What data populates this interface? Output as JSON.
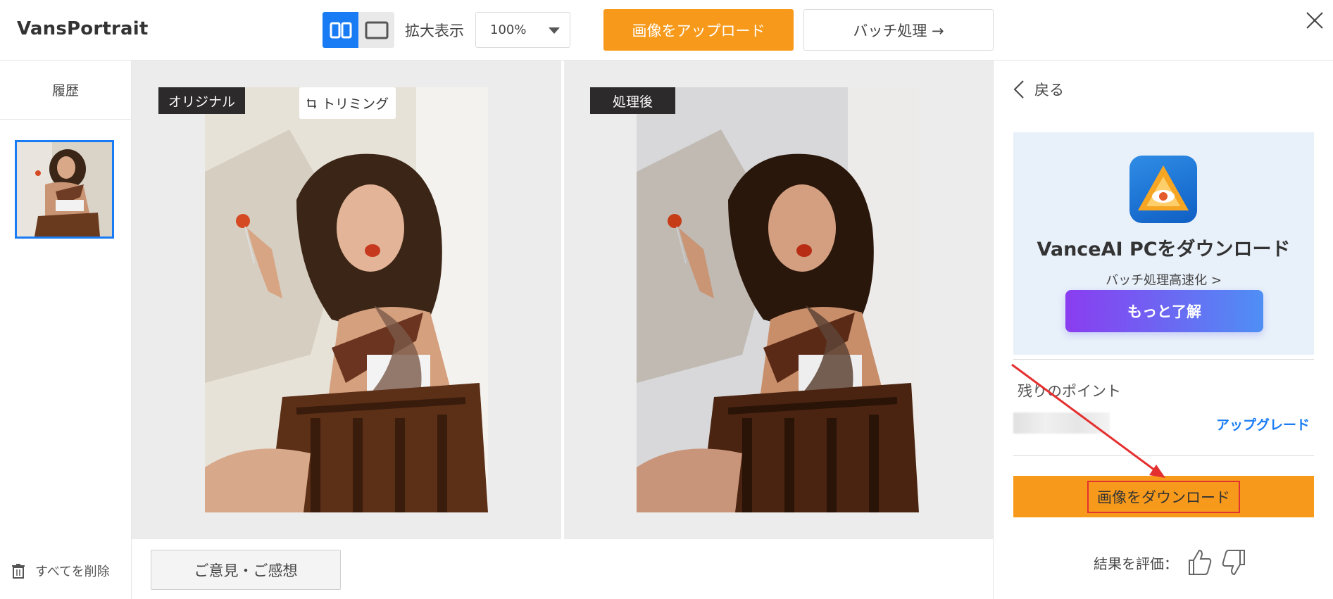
{
  "app": {
    "logo": "VansPortrait"
  },
  "toolbar": {
    "zoom_label": "拡大表示",
    "zoom_value": "100%",
    "upload_label": "画像をアップロード",
    "batch_label": "バッチ処理 →"
  },
  "sidebar": {
    "history_title": "履歴",
    "delete_all": "すべてを削除"
  },
  "compare": {
    "original_label": "オリジナル",
    "crop_label": "トリミング",
    "processed_label": "処理後"
  },
  "feedback": {
    "label": "ご意見・ご感想"
  },
  "right_panel": {
    "back_label": "戻る",
    "promo": {
      "title": "VanceAI PCをダウンロード",
      "subtitle": "バッチ処理高速化 >",
      "button": "もっと了解"
    },
    "points_title": "残りのポイント",
    "upgrade_label": "アップグレード",
    "download_label": "画像をダウンロード",
    "rate_label": "結果を評価："
  },
  "colors": {
    "accent_blue": "#1a7cf5",
    "orange": "#f79a1b",
    "highlight_red": "#e23232"
  }
}
